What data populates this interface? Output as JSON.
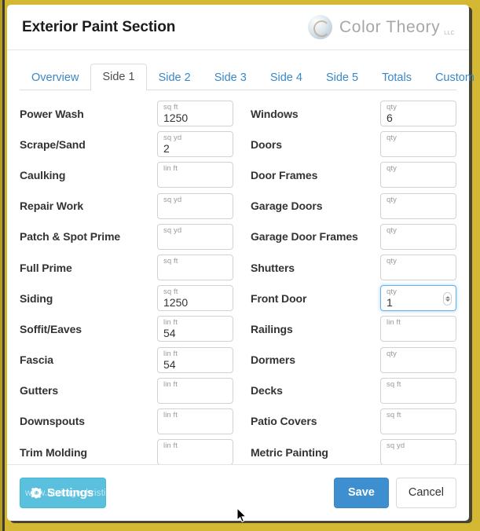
{
  "window": {
    "title": "Exterior Paint Section",
    "brand_name": "Color Theory",
    "brand_suffix": "LLC"
  },
  "tabs": [
    {
      "label": "Overview",
      "active": false
    },
    {
      "label": "Side 1",
      "active": true
    },
    {
      "label": "Side 2",
      "active": false
    },
    {
      "label": "Side 3",
      "active": false
    },
    {
      "label": "Side 4",
      "active": false
    },
    {
      "label": "Side 5",
      "active": false
    },
    {
      "label": "Totals",
      "active": false
    },
    {
      "label": "Custom",
      "active": false
    }
  ],
  "form": {
    "left": [
      {
        "label": "Power Wash",
        "unit": "sq ft",
        "value": "1250",
        "focused": false,
        "spinner": false
      },
      {
        "label": "Scrape/Sand",
        "unit": "sq yd",
        "value": "2",
        "focused": false,
        "spinner": false
      },
      {
        "label": "Caulking",
        "unit": "lin ft",
        "value": "",
        "focused": false,
        "spinner": false
      },
      {
        "label": "Repair Work",
        "unit": "sq yd",
        "value": "",
        "focused": false,
        "spinner": false
      },
      {
        "label": "Patch & Spot Prime",
        "unit": "sq yd",
        "value": "",
        "focused": false,
        "spinner": false
      },
      {
        "label": "Full Prime",
        "unit": "sq ft",
        "value": "",
        "focused": false,
        "spinner": false
      },
      {
        "label": "Siding",
        "unit": "sq ft",
        "value": "1250",
        "focused": false,
        "spinner": false
      },
      {
        "label": "Soffit/Eaves",
        "unit": "lin ft",
        "value": "54",
        "focused": false,
        "spinner": false
      },
      {
        "label": "Fascia",
        "unit": "lin ft",
        "value": "54",
        "focused": false,
        "spinner": false
      },
      {
        "label": "Gutters",
        "unit": "lin ft",
        "value": "",
        "focused": false,
        "spinner": false
      },
      {
        "label": "Downspouts",
        "unit": "lin ft",
        "value": "",
        "focused": false,
        "spinner": false
      },
      {
        "label": "Trim Molding",
        "unit": "lin ft",
        "value": "",
        "focused": false,
        "spinner": false
      }
    ],
    "right": [
      {
        "label": "Windows",
        "unit": "qty",
        "value": "6",
        "focused": false,
        "spinner": false
      },
      {
        "label": "Doors",
        "unit": "qty",
        "value": "",
        "focused": false,
        "spinner": false
      },
      {
        "label": "Door Frames",
        "unit": "qty",
        "value": "",
        "focused": false,
        "spinner": false
      },
      {
        "label": "Garage Doors",
        "unit": "qty",
        "value": "",
        "focused": false,
        "spinner": false
      },
      {
        "label": "Garage Door Frames",
        "unit": "qty",
        "value": "",
        "focused": false,
        "spinner": false
      },
      {
        "label": "Shutters",
        "unit": "qty",
        "value": "",
        "focused": false,
        "spinner": false
      },
      {
        "label": "Front Door",
        "unit": "qty",
        "value": "1",
        "focused": true,
        "spinner": true
      },
      {
        "label": "Railings",
        "unit": "lin ft",
        "value": "",
        "focused": false,
        "spinner": false
      },
      {
        "label": "Dormers",
        "unit": "qty",
        "value": "",
        "focused": false,
        "spinner": false
      },
      {
        "label": "Decks",
        "unit": "sq ft",
        "value": "",
        "focused": false,
        "spinner": false
      },
      {
        "label": "Patio Covers",
        "unit": "sq ft",
        "value": "",
        "focused": false,
        "spinner": false
      },
      {
        "label": "Metric Painting",
        "unit": "sq yd",
        "value": "",
        "focused": false,
        "spinner": false
      }
    ]
  },
  "footer": {
    "settings_label": "Settings",
    "save_label": "Save",
    "cancel_label": "Cancel"
  },
  "watermark": "www.heritagechristiancollege.com",
  "colors": {
    "page_background": "#d4b833",
    "tab_link": "#3a87c8",
    "save_button": "#3e8fd0",
    "settings_button": "#5bc0de",
    "focus_border": "#66afe9"
  }
}
